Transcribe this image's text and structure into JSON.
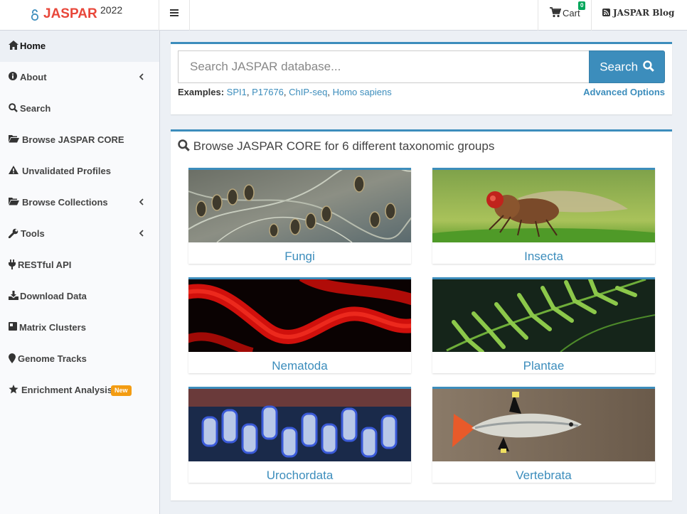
{
  "header": {
    "logo_text": "JASPAR",
    "logo_year": "2022",
    "menu_toggle_icon": "bars-icon",
    "cart_label": "Cart",
    "cart_count": "0",
    "blog_label": "JASPAR Blog"
  },
  "sidebar": {
    "items": [
      {
        "label": "Home",
        "icon": "home-icon",
        "active": true
      },
      {
        "label": "About",
        "icon": "info-circle-icon",
        "expandable": true
      },
      {
        "label": "Search",
        "icon": "search-icon"
      },
      {
        "label": "Browse JASPAR CORE",
        "icon": "folder-open-icon"
      },
      {
        "label": "Unvalidated Profiles",
        "icon": "warning-icon"
      },
      {
        "label": "Browse Collections",
        "icon": "folder-open-icon",
        "expandable": true
      },
      {
        "label": "Tools",
        "icon": "wrench-icon",
        "expandable": true
      },
      {
        "label": "RESTful API",
        "icon": "plug-icon"
      },
      {
        "label": "Download Data",
        "icon": "download-icon"
      },
      {
        "label": "Matrix Clusters",
        "icon": "cubes-icon"
      },
      {
        "label": "Genome Tracks",
        "icon": "map-marker-icon"
      },
      {
        "label": "Enrichment Analysis",
        "icon": "star-icon",
        "badge": "New"
      }
    ]
  },
  "search": {
    "placeholder": "Search JASPAR database...",
    "button_label": "Search",
    "examples_label": "Examples:",
    "examples": [
      "SPI1",
      "P17676",
      "ChIP-seq",
      "Homo sapiens"
    ],
    "advanced_label": "Advanced Options"
  },
  "browse": {
    "title": "Browse JASPAR CORE for 6 different taxonomic groups",
    "groups": [
      "Fungi",
      "Insecta",
      "Nematoda",
      "Plantae",
      "Urochordata",
      "Vertebrata"
    ]
  },
  "colors": {
    "accent": "#3c8dbc",
    "logo_red": "#e8473a",
    "badge_green": "#00a65a",
    "badge_orange": "#f39c12"
  }
}
